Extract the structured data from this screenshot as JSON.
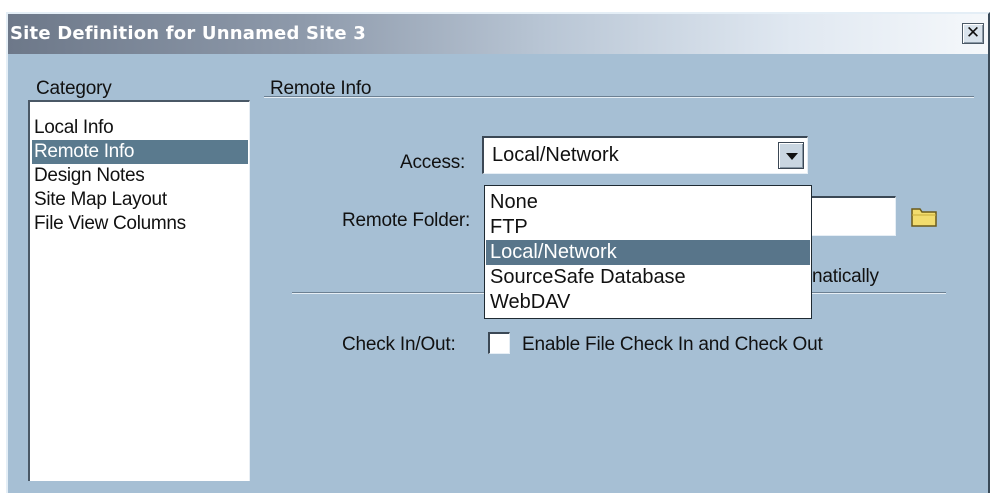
{
  "window": {
    "title": "Site Definition for Unnamed Site 3",
    "close_glyph": "✕"
  },
  "sidebar": {
    "heading": "Category",
    "items": [
      {
        "label": "Local Info",
        "selected": false
      },
      {
        "label": "Remote Info",
        "selected": true
      },
      {
        "label": "Design Notes",
        "selected": false
      },
      {
        "label": "Site Map Layout",
        "selected": false
      },
      {
        "label": "File View Columns",
        "selected": false
      }
    ]
  },
  "panel": {
    "heading": "Remote Info",
    "access_label": "Access:",
    "access_value": "Local/Network",
    "access_options": [
      {
        "label": "None",
        "selected": false
      },
      {
        "label": "FTP",
        "selected": false
      },
      {
        "label": "Local/Network",
        "selected": true
      },
      {
        "label": "SourceSafe Database",
        "selected": false
      },
      {
        "label": "WebDAV",
        "selected": false
      }
    ],
    "remote_folder_label": "Remote Folder:",
    "remote_folder_value": "",
    "auto_refresh_partial": "natically",
    "check_label": "Check In/Out:",
    "check_option_label": "Enable File Check In and Check Out",
    "check_option_checked": false
  },
  "icons": {
    "folder": "folder-icon",
    "dropdown": "chevron-down-icon",
    "close": "close-icon"
  },
  "colors": {
    "dialog_bg": "#a6bfd4",
    "selection": "#5a7a8e"
  }
}
